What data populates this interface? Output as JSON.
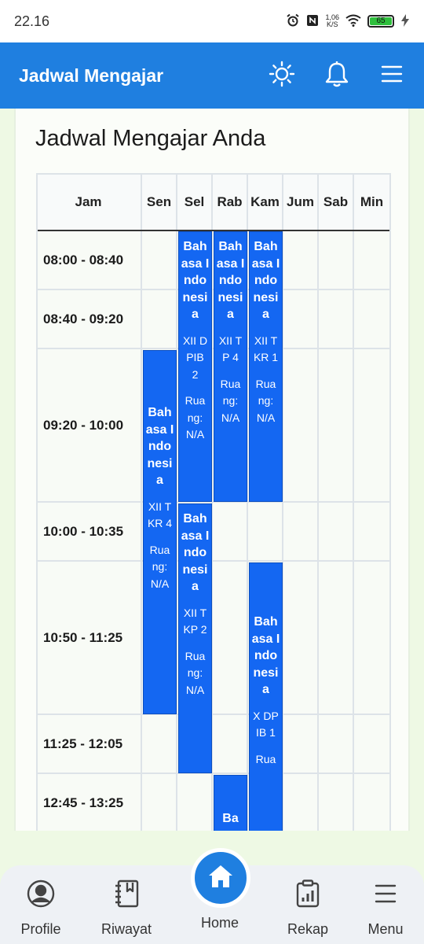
{
  "status": {
    "time": "22.16",
    "net_speed": "1,06",
    "net_unit": "K/S",
    "battery": "65"
  },
  "appbar": {
    "title": "Jadwal Mengajar",
    "icons": [
      "sun-icon",
      "bell-icon",
      "menu-icon"
    ]
  },
  "page": {
    "title": "Jadwal Mengajar Anda"
  },
  "table": {
    "head_time": "Jam",
    "days": [
      "Sen",
      "Sel",
      "Rab",
      "Kam",
      "Jum",
      "Sab",
      "Min"
    ],
    "times": [
      "08:00 - 08:40",
      "08:40 - 09:20",
      "09:20 - 10:00",
      "10:00 - 10:35",
      "10:50 - 11:25",
      "11:25 - 12:05",
      "12:45 - 13:25"
    ]
  },
  "schedule": [
    {
      "subject": "Bahasa Indonesia",
      "class": "XII DPIB 2",
      "room": "Ruang: N/A"
    },
    {
      "subject": "Bahasa Indonesia",
      "class": "XII TP 4",
      "room": "Ruang: N/A"
    },
    {
      "subject": "Bahasa Indonesia",
      "class": "XII TKR 1",
      "room": "Ruang: N/A"
    },
    {
      "subject": "Bahasa Indonesia",
      "class": "XII TKR 4",
      "room": "Ruang: N/A"
    },
    {
      "subject": "Bahasa Indonesia",
      "class": "XII TKP 2",
      "room": "Ruang: N/A"
    },
    {
      "subject": "Bahasa Indonesia",
      "class": "X DPIB 1",
      "room": "Rua"
    },
    {
      "subject": "Ba"
    }
  ],
  "nav": {
    "profile": "Profile",
    "riwayat": "Riwayat",
    "home": "Home",
    "rekap": "Rekap",
    "menu": "Menu"
  },
  "colors": {
    "primary": "#1f7fe0",
    "slot": "#1467f2",
    "background": "#eef9e4"
  }
}
